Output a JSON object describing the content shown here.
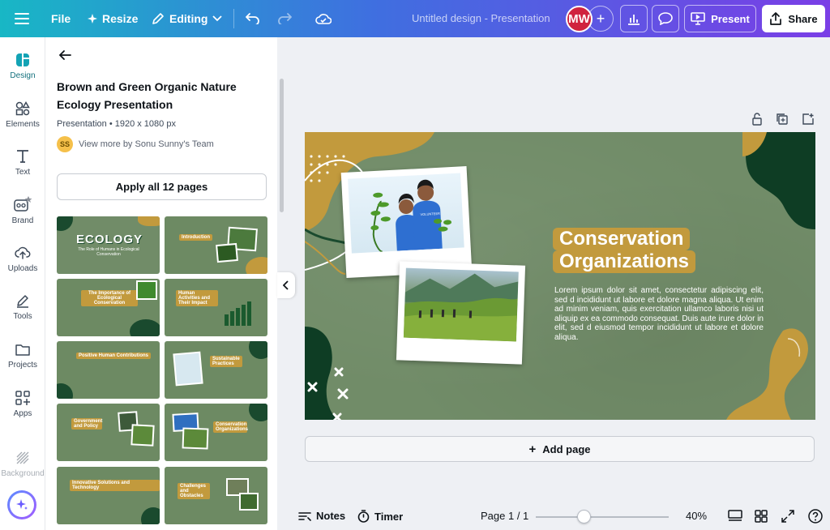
{
  "topbar": {
    "file": "File",
    "resize": "Resize",
    "editing": "Editing",
    "doc_title": "Untitled design - Presentation",
    "avatar": "MW",
    "present": "Present",
    "share": "Share"
  },
  "rail": {
    "items": [
      {
        "label": "Design",
        "icon": "design-icon"
      },
      {
        "label": "Elements",
        "icon": "elements-icon"
      },
      {
        "label": "Text",
        "icon": "text-icon"
      },
      {
        "label": "Brand",
        "icon": "brand-icon"
      },
      {
        "label": "Uploads",
        "icon": "uploads-icon"
      },
      {
        "label": "Tools",
        "icon": "tools-icon"
      },
      {
        "label": "Projects",
        "icon": "projects-icon"
      },
      {
        "label": "Apps",
        "icon": "apps-icon"
      },
      {
        "label": "Background",
        "icon": "background-icon"
      }
    ]
  },
  "panel": {
    "title": "Brown and Green Organic Nature Ecology Presentation",
    "subtitle": "Presentation • 1920 x 1080 px",
    "team_initials": "SS",
    "team_link": "View more by Sonu Sunny's Team",
    "apply_button": "Apply all 12 pages",
    "thumbnails": [
      {
        "label": "ECOLOGY",
        "sub": "The Role of Humans in Ecological Conservation"
      },
      {
        "label": "Introduction"
      },
      {
        "label": "The Importance of Ecological Conservation"
      },
      {
        "label": "Human Activities and Their Impact"
      },
      {
        "label": "Positive Human Contributions"
      },
      {
        "label": "Sustainable Practices"
      },
      {
        "label": "Government and Policy"
      },
      {
        "label": "Conservation Organizations"
      },
      {
        "label": "Innovative Solutions and Technology"
      },
      {
        "label": "Challenges and Obstacles"
      }
    ]
  },
  "slide": {
    "title_line1": "Conservation",
    "title_line2": "Organizations",
    "body": "Lorem ipsum dolor sit amet, consectetur adipiscing elit, sed d incididunt ut labore et dolore magna aliqua. Ut enim ad minim veniam, quis exercitation ullamco laboris nisi ut aliquip ex ea commodo consequat. Duis aute irure dolor in elit, sed d eiusmod tempor incididunt ut labore et dolore aliqua.",
    "shirt_text": "VOLUNTEER",
    "colors": {
      "bg": "#718c68",
      "accent": "#c29a3d",
      "dark": "#1a4a2e"
    }
  },
  "canvas": {
    "add_page": "Add page"
  },
  "bottombar": {
    "notes": "Notes",
    "timer": "Timer",
    "page": "Page 1 / 1",
    "zoom": "40%",
    "zoom_level": 0.4
  }
}
